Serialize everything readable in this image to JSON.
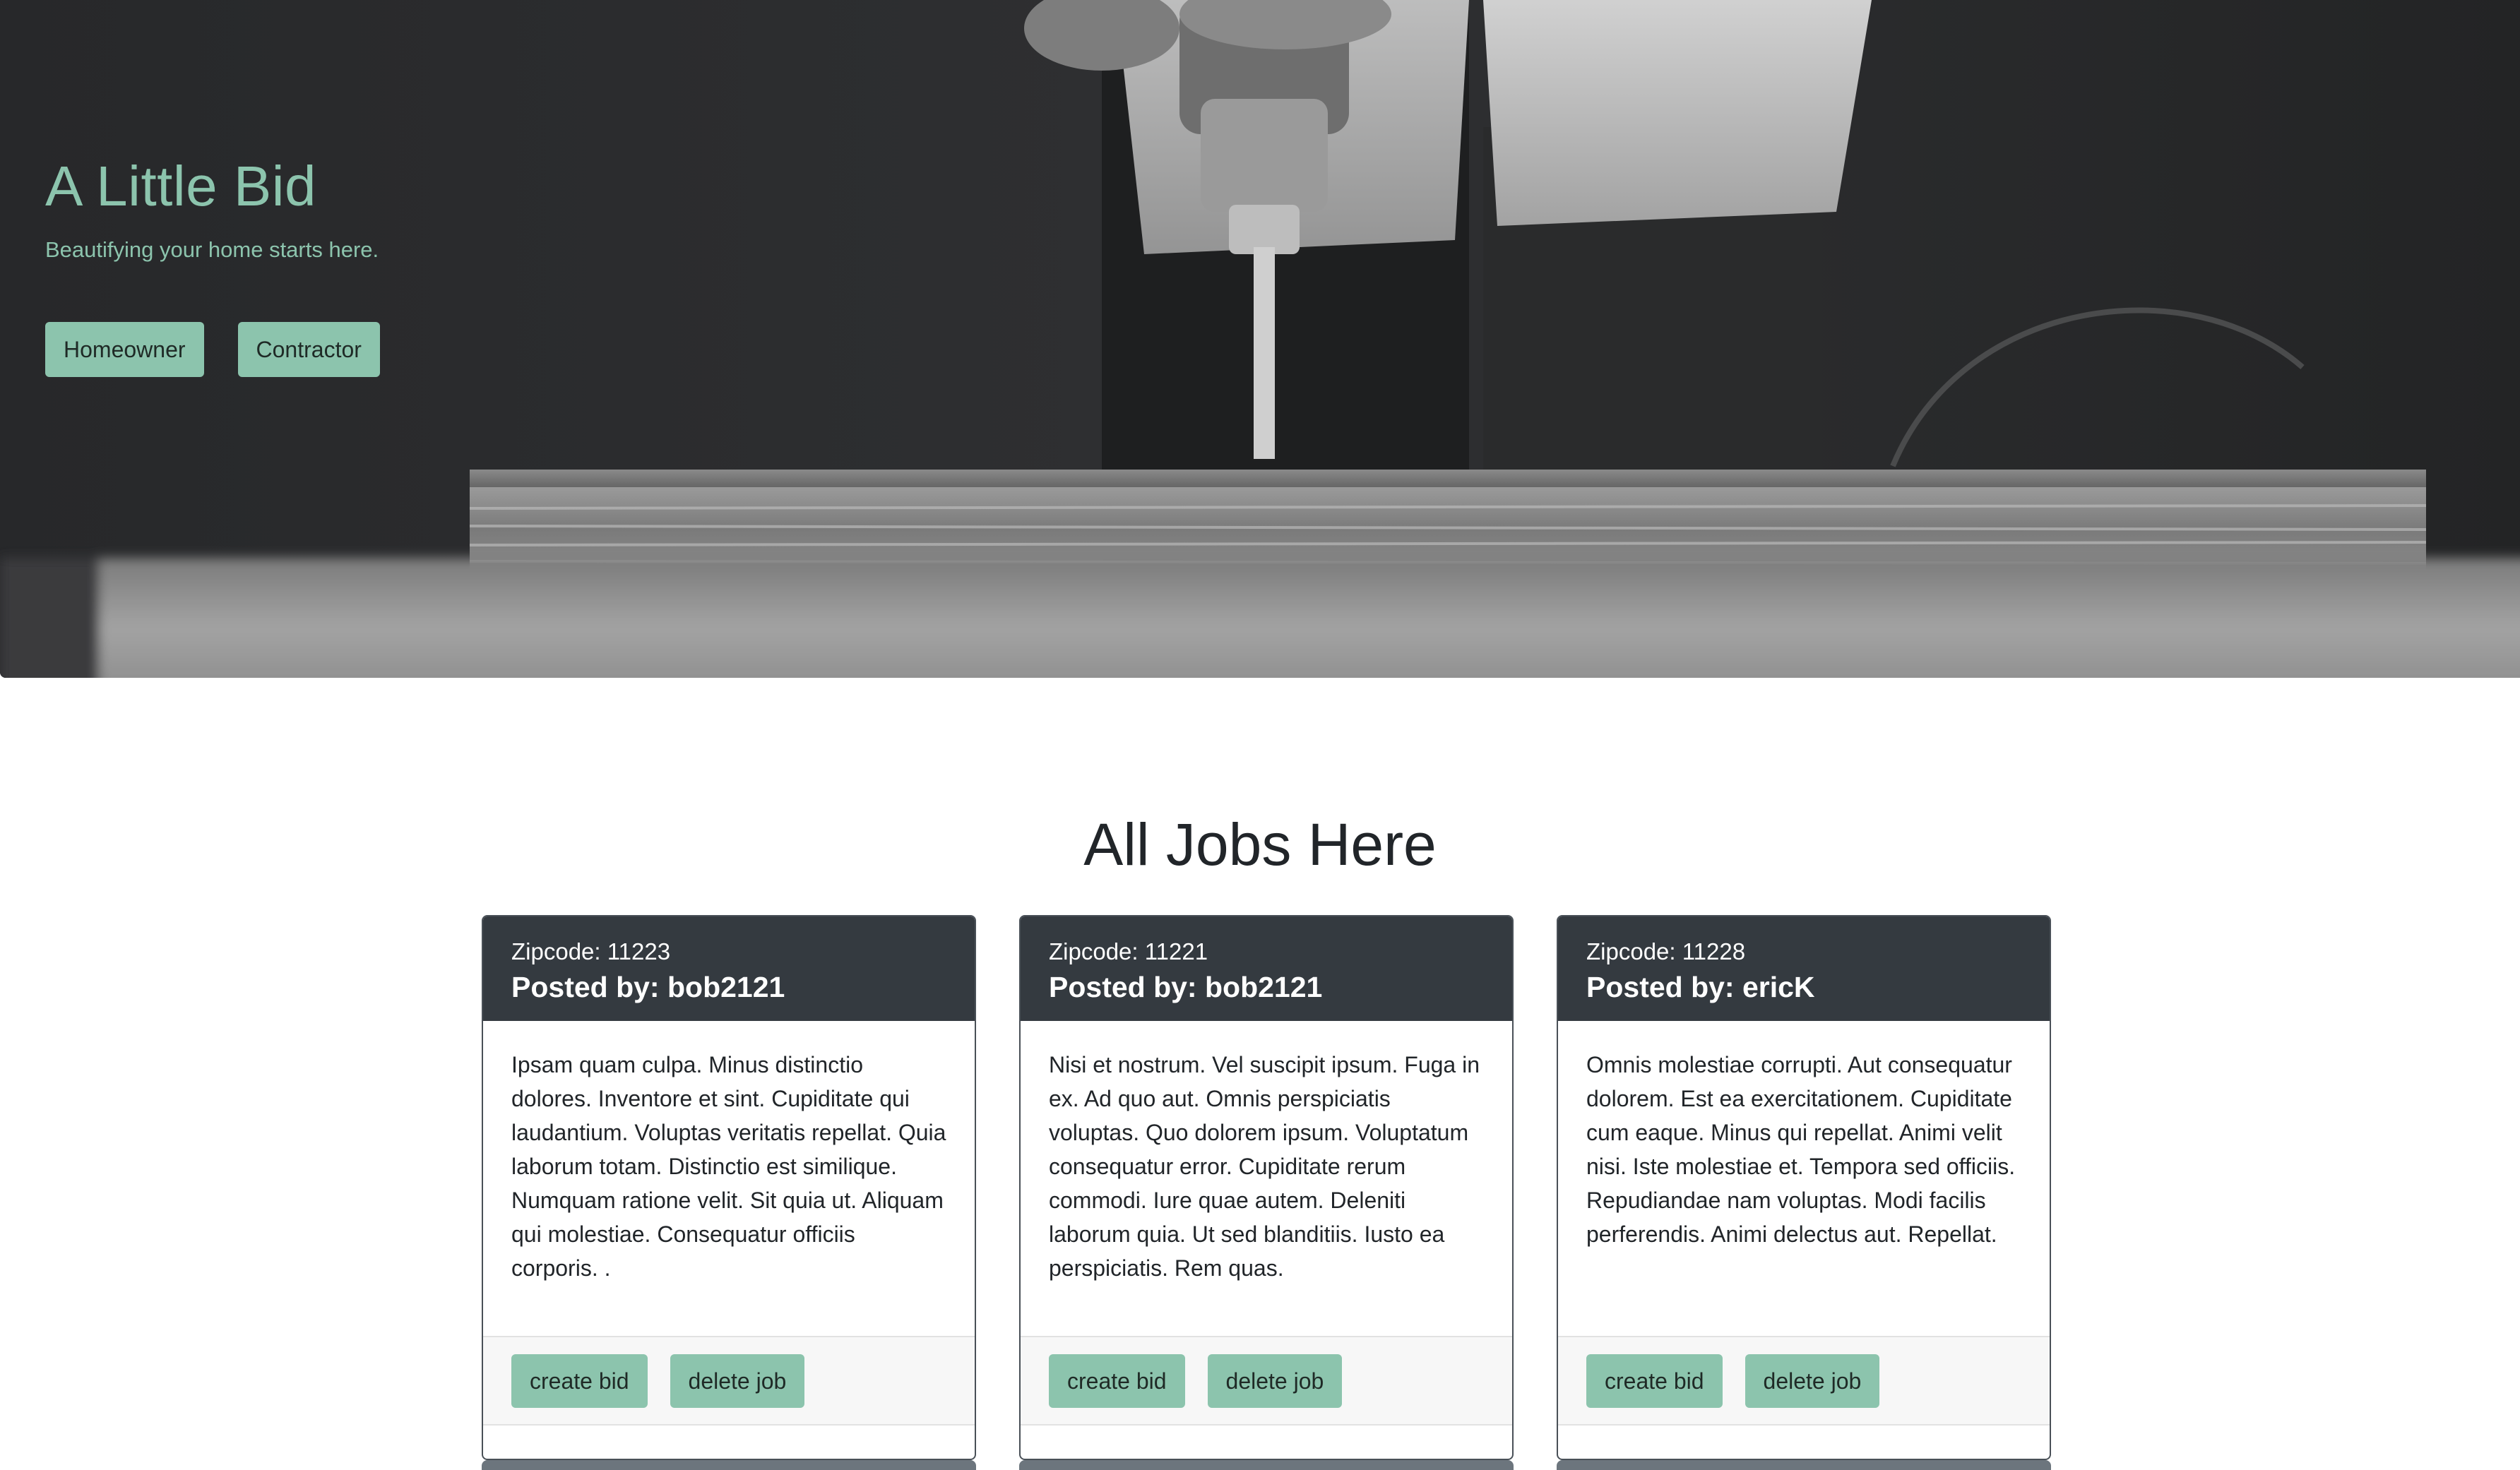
{
  "hero": {
    "title": "A Little Bid",
    "tagline": "Beautifying your home starts here.",
    "buttons": [
      "Homeowner",
      "Contractor"
    ],
    "image": "black-and-white photo of hands using a power drill on a wooden board"
  },
  "main": {
    "heading": "All Jobs Here",
    "jobs": [
      {
        "zipcode": "Zipcode: 11223",
        "posted_by": "Posted by: bob2121",
        "description": "Ipsam quam culpa. Minus distinctio dolores. Inventore et sint. Cupiditate qui laudantium. Voluptas veritatis repellat. Quia laborum totam. Distinctio est similique. Numquam ratione velit. Sit quia ut. Aliquam qui molestiae. Consequatur officiis corporis. .",
        "create_label": "create bid",
        "delete_label": "delete job"
      },
      {
        "zipcode": "Zipcode: 11221",
        "posted_by": "Posted by: bob2121",
        "description": "Nisi et nostrum. Vel suscipit ipsum. Fuga in ex. Ad quo aut. Omnis perspiciatis voluptas. Quo dolorem ipsum. Voluptatum consequatur error. Cupiditate rerum commodi. Iure quae autem. Deleniti laborum quia. Ut sed blanditiis. Iusto ea perspiciatis. Rem quas.",
        "create_label": "create bid",
        "delete_label": "delete job"
      },
      {
        "zipcode": "Zipcode: 11228",
        "posted_by": "Posted by: ericK",
        "description": "Omnis molestiae corrupti. Aut consequatur dolorem. Est ea exercitationem. Cupiditate cum eaque. Minus qui repellat. Animi velit nisi. Iste molestiae et. Tempora sed officiis. Repudiandae nam voluptas. Modi facilis perferendis. Animi delectus aut. Repellat.",
        "create_label": "create bid",
        "delete_label": "delete job"
      }
    ]
  },
  "colors": {
    "accent": "#8cc4ad",
    "card_header": "#343a40",
    "text": "#212529"
  }
}
